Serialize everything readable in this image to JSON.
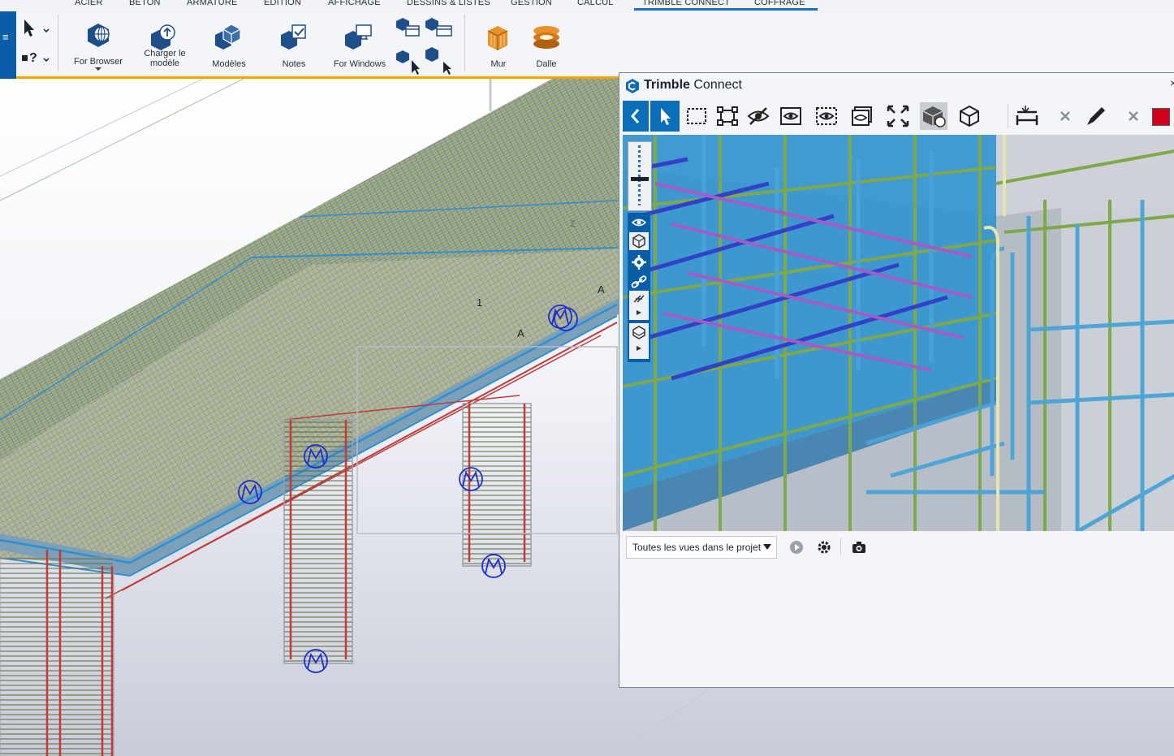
{
  "menu": {
    "tabs": [
      "ACIER",
      "BETON",
      "ARMATURE",
      "EDITION",
      "AFFICHAGE",
      "DESSINS & LISTES",
      "GESTION",
      "CALCUL",
      "TRIMBLE CONNECT",
      "COFFRAGE"
    ],
    "active_tab": "TRIMBLE CONNECT"
  },
  "ribbon": {
    "for_browser": "For Browser",
    "charger_line1": "Charger le",
    "charger_line2": "modèle",
    "modeles": "Modèles",
    "notes": "Notes",
    "for_windows": "For Windows",
    "mur": "Mur",
    "dalle": "Dalle"
  },
  "model": {
    "labels": [
      "A",
      "A",
      "1",
      "Z"
    ]
  },
  "trimble": {
    "title_brand": "Trimble",
    "title_product": "Connect",
    "views_select": "Toutes les vues dans le projet",
    "accent": "#0a6fb8",
    "red_swatch": "#d0021b"
  }
}
